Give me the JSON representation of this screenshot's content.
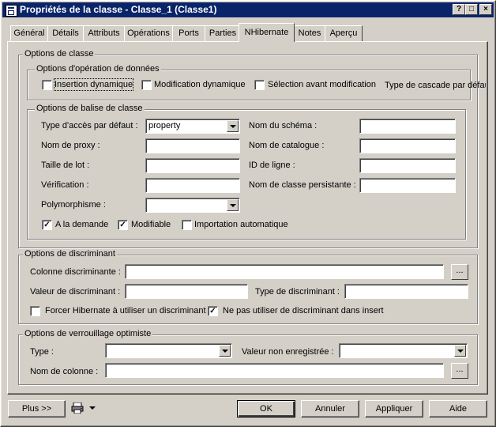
{
  "window": {
    "title": "Propriétés de la classe - Classe_1 (Classe1)"
  },
  "tabs": [
    "Général",
    "Détails",
    "Attributs",
    "Opérations",
    "Ports",
    "Parties",
    "NHibernate",
    "Notes",
    "Aperçu"
  ],
  "active_tab": "NHibernate",
  "class_options": {
    "title": "Options de classe",
    "data_ops": {
      "title": "Options d'opération de données",
      "insert_dynamic": {
        "label": "Insertion dynamique",
        "checked": false
      },
      "update_dynamic": {
        "label": "Modification dynamique",
        "checked": false
      },
      "select_before_update": {
        "label": "Sélection avant modification",
        "checked": false
      },
      "cascade_type": {
        "label": "Type de cascade par défau"
      }
    },
    "mapping": {
      "title": "Options de balise de classe",
      "access_type": {
        "label": "Type d'accès par défaut :",
        "value": "property"
      },
      "proxy_name": {
        "label": "Nom de proxy :",
        "value": ""
      },
      "batch_size": {
        "label": "Taille de lot :",
        "value": ""
      },
      "check": {
        "label": "Vérification :",
        "value": ""
      },
      "polymorphism": {
        "label": "Polymorphisme :",
        "value": ""
      },
      "schema_name": {
        "label": "Nom du schéma :",
        "value": ""
      },
      "catalog_name": {
        "label": "Nom de catalogue :",
        "value": ""
      },
      "row_id": {
        "label": "ID de ligne :",
        "value": ""
      },
      "persister_class": {
        "label": "Nom de classe persistante :",
        "value": ""
      },
      "lazy": {
        "label": "A la demande",
        "checked": true
      },
      "mutable": {
        "label": "Modifiable",
        "checked": true
      },
      "auto_import": {
        "label": "Importation automatique",
        "checked": false
      }
    }
  },
  "discriminator": {
    "title": "Options de discriminant",
    "column": {
      "label": "Colonne discriminante :",
      "value": "",
      "button": "..."
    },
    "value": {
      "label": "Valeur de discriminant :",
      "value": ""
    },
    "type": {
      "label": "Type de discriminant :",
      "value": ""
    },
    "force": {
      "label": "Forcer Hibernate à utiliser un discriminant",
      "checked": false
    },
    "no_insert": {
      "label": "Ne pas utiliser de discriminant dans insert",
      "checked": true
    }
  },
  "locking": {
    "title": "Options de verrouillage optimiste",
    "type": {
      "label": "Type :",
      "value": ""
    },
    "unsaved_value": {
      "label": "Valeur non enregistrée :",
      "value": ""
    },
    "column_name": {
      "label": "Nom de colonne :",
      "value": "",
      "button": "..."
    }
  },
  "footer": {
    "more": "Plus >>",
    "ok": "OK",
    "cancel": "Annuler",
    "apply": "Appliquer",
    "help": "Aide"
  },
  "titlebar_buttons": {
    "help": "?",
    "maximize": "□",
    "close": "×"
  },
  "colors": {
    "titlebar": "#0a246a",
    "face": "#d4d0c8"
  }
}
